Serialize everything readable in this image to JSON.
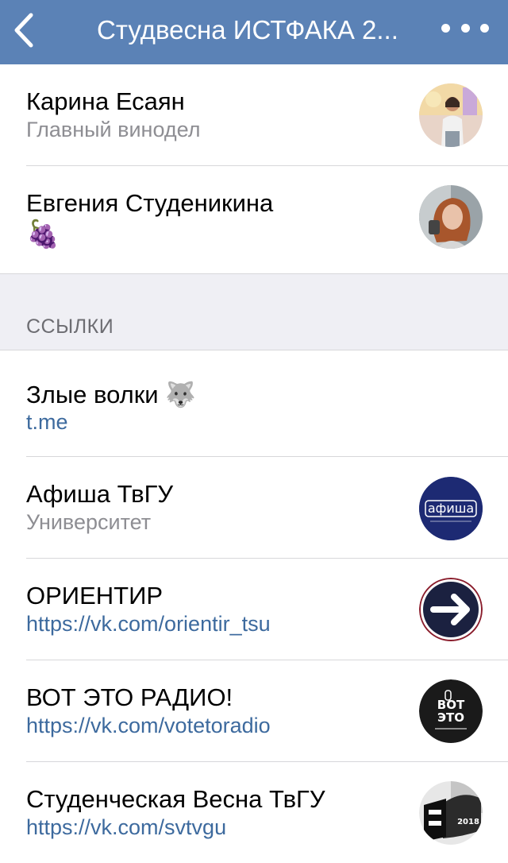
{
  "header": {
    "title": "Студвесна ИСТФАКА 2...",
    "back_icon": "chevron-left-icon",
    "more_icon": "more-horizontal-icon",
    "bg_color": "#5b82b6"
  },
  "people": [
    {
      "name": "Карина Есаян",
      "subtitle": "Главный винодел"
    },
    {
      "name": "Евгения Студеникина",
      "subtitle": "🍇"
    }
  ],
  "section_links": {
    "label": "ССЫЛКИ"
  },
  "links": [
    {
      "title": "Злые волки 🐺",
      "subtitle": "t.me",
      "icon": null
    },
    {
      "title": "Афиша ТвГУ",
      "subtitle": "Университет",
      "icon": "afisha-logo",
      "logo_text": "афиша"
    },
    {
      "title": "ОРИЕНТИР",
      "subtitle": "https://vk.com/orientir_tsu",
      "icon": "arrow-right-logo"
    },
    {
      "title": "ВОТ ЭТО РАДИО!",
      "subtitle": "https://vk.com/votetoradio",
      "icon": "radio-logo",
      "logo_text_top": "ВОТ",
      "logo_text_bottom": "ЭТО"
    },
    {
      "title": "Студенческая Весна ТвГУ",
      "subtitle": "https://vk.com/svtvgu",
      "icon": "vesna-logo",
      "logo_text": "2018"
    }
  ]
}
